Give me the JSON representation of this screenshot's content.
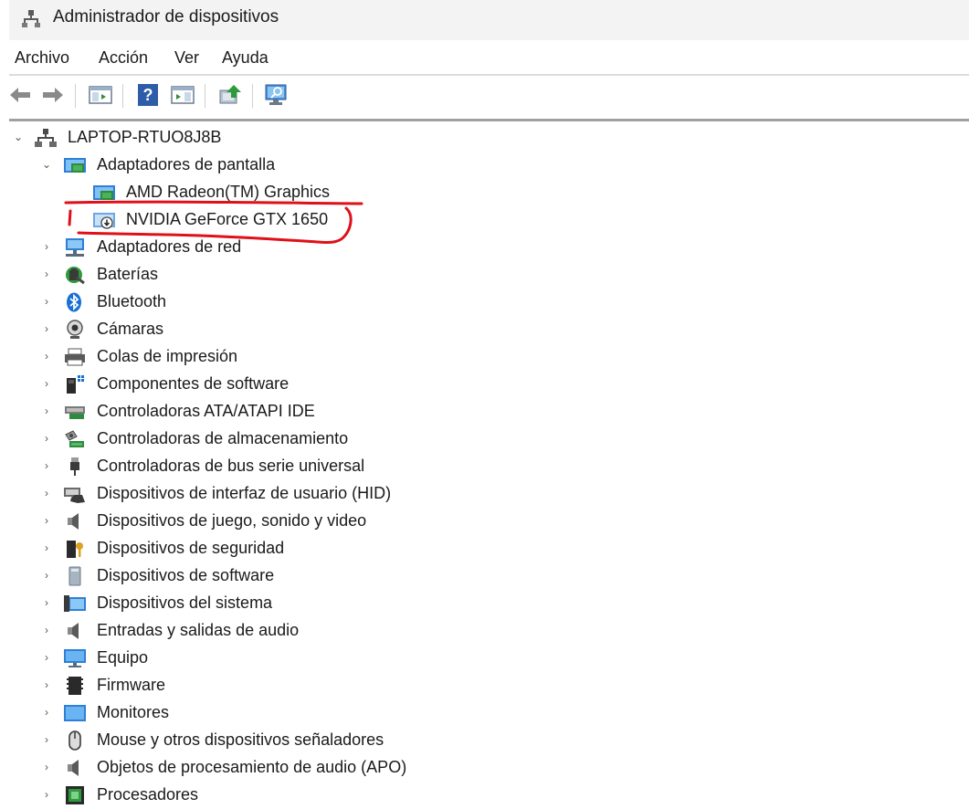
{
  "window": {
    "title": "Administrador de dispositivos"
  },
  "menu": [
    "Archivo",
    "Acción",
    "Ver",
    "Ayuda"
  ],
  "toolbar": {
    "buttons": [
      "back-arrow-icon",
      "forward-arrow-icon",
      "show-hide-console-tree-icon",
      "help-icon",
      "properties-icon",
      "update-driver-icon",
      "scan-hardware-icon"
    ]
  },
  "tree": {
    "root": "LAPTOP-RTUO8J8B",
    "expanded_category": "Adaptadores de pantalla",
    "children": [
      "AMD Radeon(TM) Graphics",
      "NVIDIA GeForce GTX 1650"
    ],
    "categories": [
      "Adaptadores de red",
      "Baterías",
      "Bluetooth",
      "Cámaras",
      "Colas de impresión",
      "Componentes de software",
      "Controladoras ATA/ATAPI IDE",
      "Controladoras de almacenamiento",
      "Controladoras de bus serie universal",
      "Dispositivos de interfaz de usuario (HID)",
      "Dispositivos de juego, sonido y video",
      "Dispositivos de seguridad",
      "Dispositivos de software",
      "Dispositivos del sistema",
      "Entradas y salidas de audio",
      "Equipo",
      "Firmware",
      "Monitores",
      "Mouse y otros dispositivos señaladores",
      "Objetos de procesamiento de audio (APO)",
      "Procesadores"
    ]
  },
  "annotation": {
    "color": "#e0101a",
    "target": "NVIDIA GeForce GTX 1650"
  }
}
